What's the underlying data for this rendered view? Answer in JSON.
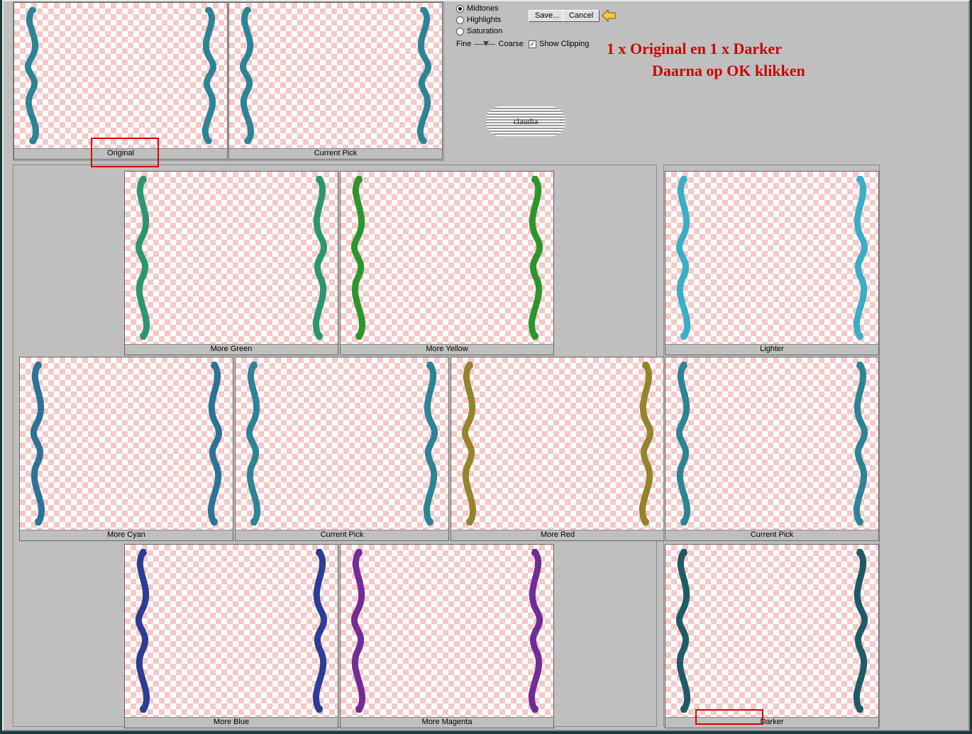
{
  "radios": {
    "midtones": "Midtones",
    "highlights": "Highlights",
    "saturation": "Saturation"
  },
  "slider": {
    "fine": "Fine",
    "coarse": "Coarse"
  },
  "checkbox": {
    "showclipping": "Show Clipping"
  },
  "buttons": {
    "save": "Save...",
    "cancel": "Cancel"
  },
  "instruction": {
    "line1": "1 x Original en 1 x Darker",
    "line2": "Daarna op OK klikken"
  },
  "watermark": "claudia",
  "top": {
    "original": "Original",
    "currentpick": "Current Pick"
  },
  "variations": {
    "moregreen": "More Green",
    "moreyellow": "More Yellow",
    "morecyan": "More Cyan",
    "currentpick": "Current Pick",
    "morered": "More Red",
    "moreblue": "More Blue",
    "moremagenta": "More Magenta"
  },
  "brightness": {
    "lighter": "Lighter",
    "currentpick": "Current Pick",
    "darker": "Darker"
  },
  "flourish_color": "#2b8a9e"
}
